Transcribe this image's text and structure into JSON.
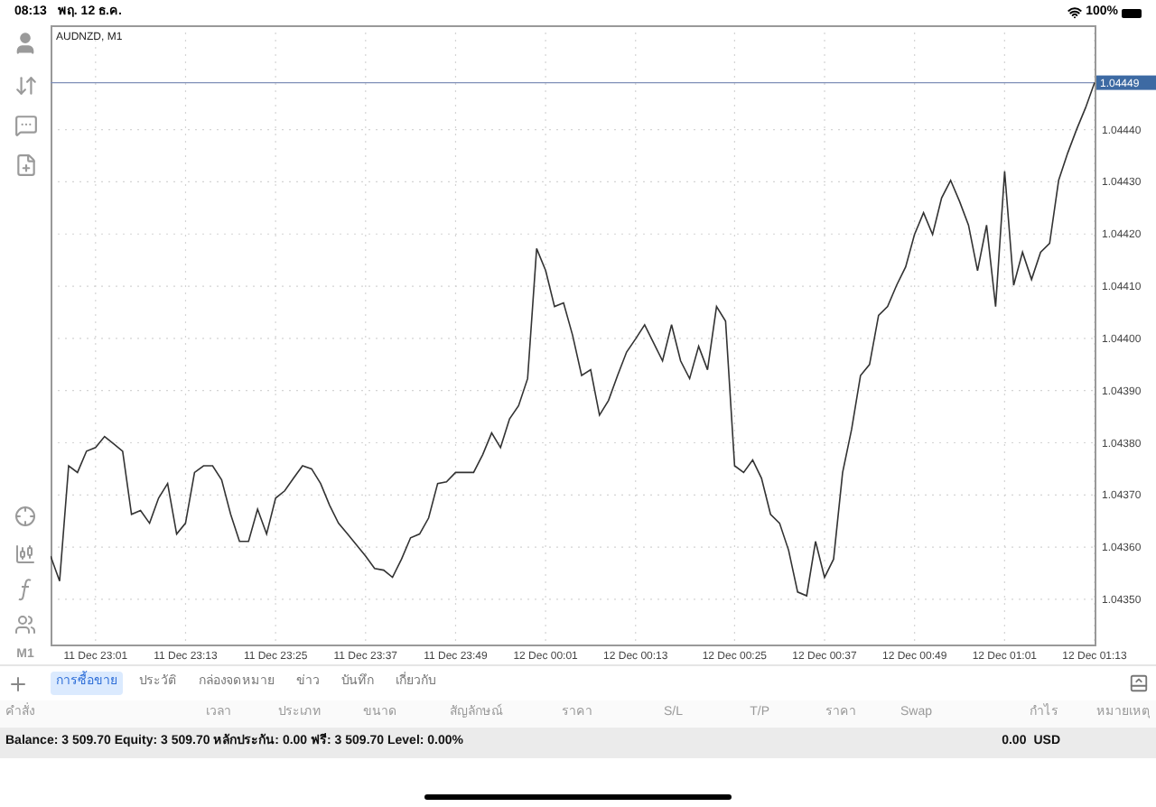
{
  "status_bar": {
    "time": "08:13",
    "date": "พฤ. 12 ธ.ค.",
    "battery": "100%"
  },
  "sidebar": {
    "timeframe": "M1"
  },
  "chart": {
    "title": "AUDNZD, M1",
    "chart_data": {
      "type": "line",
      "grid": true,
      "ylim": [
        1.04341,
        1.0446
      ],
      "categories": [
        null,
        null,
        null,
        null,
        null,
        "11 Dec 23:01",
        null,
        null,
        null,
        null,
        null,
        null,
        null,
        null,
        null,
        "11 Dec 23:13",
        null,
        null,
        null,
        null,
        null,
        null,
        null,
        null,
        null,
        "11 Dec 23:25",
        null,
        null,
        null,
        null,
        null,
        null,
        null,
        null,
        null,
        "11 Dec 23:37",
        null,
        null,
        null,
        null,
        null,
        null,
        null,
        null,
        null,
        "11 Dec 23:49",
        null,
        null,
        null,
        null,
        null,
        null,
        null,
        null,
        null,
        "12 Dec 00:01",
        null,
        null,
        null,
        null,
        null,
        null,
        null,
        null,
        null,
        "12 Dec 00:13",
        null,
        null,
        null,
        null,
        null,
        null,
        null,
        null,
        null,
        null,
        "12 Dec 00:25",
        null,
        null,
        null,
        null,
        null,
        null,
        null,
        null,
        null,
        "12 Dec 00:37",
        null,
        null,
        null,
        null,
        null,
        null,
        null,
        null,
        null,
        "12 Dec 00:49",
        null,
        null,
        null,
        null,
        null,
        null,
        null,
        null,
        null,
        "12 Dec 01:01",
        null,
        null,
        null,
        null,
        null,
        null,
        null,
        null,
        null,
        "12 Dec 01:13"
      ],
      "yticks": [
        {
          "value": 1.0435,
          "label": "1.04350"
        },
        {
          "value": 1.0436,
          "label": "1.04360"
        },
        {
          "value": 1.0437,
          "label": "1.04370"
        },
        {
          "value": 1.0438,
          "label": "1.04380"
        },
        {
          "value": 1.0439,
          "label": "1.04390"
        },
        {
          "value": 1.044,
          "label": "1.04400"
        },
        {
          "value": 1.0441,
          "label": "1.04410"
        },
        {
          "value": 1.0442,
          "label": "1.04420"
        },
        {
          "value": 1.0443,
          "label": "1.04430"
        },
        {
          "value": 1.0444,
          "label": "1.04440"
        }
      ],
      "ref_lines": [
        {
          "axis": "y",
          "value": 1.04449,
          "label": "1.04449",
          "color": "#7f8fb8"
        }
      ],
      "series": [
        {
          "color": "#333333",
          "values": [
            1.043583,
            1.043535,
            1.043756,
            1.043743,
            1.043784,
            1.043791,
            1.043812,
            1.043798,
            1.043784,
            1.043663,
            1.04367,
            1.043646,
            1.043694,
            1.043722,
            1.043625,
            1.043646,
            1.043743,
            1.043756,
            1.043756,
            1.043729,
            1.043663,
            1.043611,
            1.043611,
            1.043673,
            1.043625,
            1.043694,
            1.043708,
            1.043732,
            1.043756,
            1.04375,
            1.043722,
            1.04368,
            1.043646,
            1.043625,
            1.043604,
            1.043583,
            1.043559,
            1.043556,
            1.043542,
            1.043577,
            1.043618,
            1.043625,
            1.043656,
            1.043722,
            1.043725,
            1.043743,
            1.043743,
            1.043743,
            1.043777,
            1.043819,
            1.043791,
            1.043846,
            1.043871,
            1.043923,
            1.044172,
            1.04413,
            1.044061,
            1.044068,
            1.044006,
            1.043929,
            1.04394,
            1.043853,
            1.043881,
            1.043929,
            1.043974,
            1.043999,
            1.044026,
            1.043992,
            1.043957,
            1.044026,
            1.043957,
            1.043923,
            1.043985,
            1.04394,
            1.044061,
            1.044033,
            1.043756,
            1.043743,
            1.043767,
            1.043732,
            1.043663,
            1.043646,
            1.043594,
            1.043514,
            1.043507,
            1.043611,
            1.043542,
            1.043577,
            1.043743,
            1.043826,
            1.043929,
            1.04395,
            1.044044,
            1.044061,
            1.044102,
            1.044137,
            1.044199,
            1.044241,
            1.044199,
            1.044269,
            1.044303,
            1.044262,
            1.044217,
            1.04413,
            1.044217,
            1.044061,
            1.04432,
            1.044102,
            1.044165,
            1.044113,
            1.044165,
            1.044182,
            1.044303,
            1.044355,
            1.0444,
            1.044442,
            1.04449
          ]
        }
      ]
    }
  },
  "toolbar": {
    "tabs": [
      {
        "label": "การซื้อขาย",
        "selected": true
      },
      {
        "label": "ประวัติ",
        "selected": false
      },
      {
        "label": "กล่องจดหมาย",
        "selected": false
      },
      {
        "label": "ข่าว",
        "selected": false
      },
      {
        "label": "บันทึก",
        "selected": false
      },
      {
        "label": "เกี่ยวกับ",
        "selected": false
      }
    ]
  },
  "table": {
    "columns": [
      "คำสั่ง",
      "เวลา",
      "ประเภท",
      "ขนาด",
      "สัญลักษณ์",
      "ราคา",
      "S/L",
      "T/P",
      "ราคา",
      "Swap",
      "กำไร",
      "หมายเหตุ"
    ]
  },
  "summary": {
    "text": "Balance: 3 509.70 Equity: 3 509.70 หลักประกัน: 0.00 ฟรี: 3 509.70 Level: 0.00%",
    "profit": "0.00",
    "currency": "USD"
  }
}
